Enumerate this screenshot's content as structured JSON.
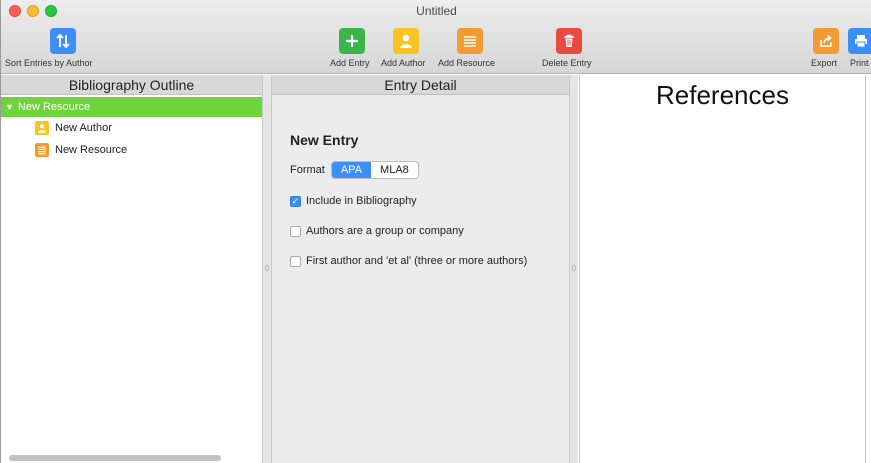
{
  "window": {
    "title": "Untitled"
  },
  "toolbar": {
    "sort_label": "Sort Entries by Author",
    "add_entry_label": "Add Entry",
    "add_author_label": "Add Author",
    "add_resource_label": "Add Resource",
    "delete_entry_label": "Delete Entry",
    "export_label": "Export",
    "print_label": "Print",
    "colors": {
      "green": "#3bb54a",
      "yellow": "#f7c325",
      "orange": "#f29a33",
      "red": "#ea4943",
      "blue": "#3d8ff5"
    }
  },
  "outline": {
    "header": "Bibliography Outline",
    "root": {
      "label": "New Resource",
      "expanded": true
    },
    "children": [
      {
        "label": "New Author",
        "icon": "author-icon"
      },
      {
        "label": "New Resource",
        "icon": "resource-icon"
      }
    ],
    "selected_color": "#6fd43c"
  },
  "detail": {
    "header": "Entry Detail",
    "entry_title": "New Entry",
    "format_label": "Format",
    "formats": [
      "APA",
      "MLA8"
    ],
    "selected_format": "APA",
    "options": [
      {
        "label": "Include in Bibliography",
        "checked": true
      },
      {
        "label": "Authors are a group or company",
        "checked": false
      },
      {
        "label": "First author and 'et al' (three or more authors)",
        "checked": false
      }
    ]
  },
  "references": {
    "title": "References"
  }
}
